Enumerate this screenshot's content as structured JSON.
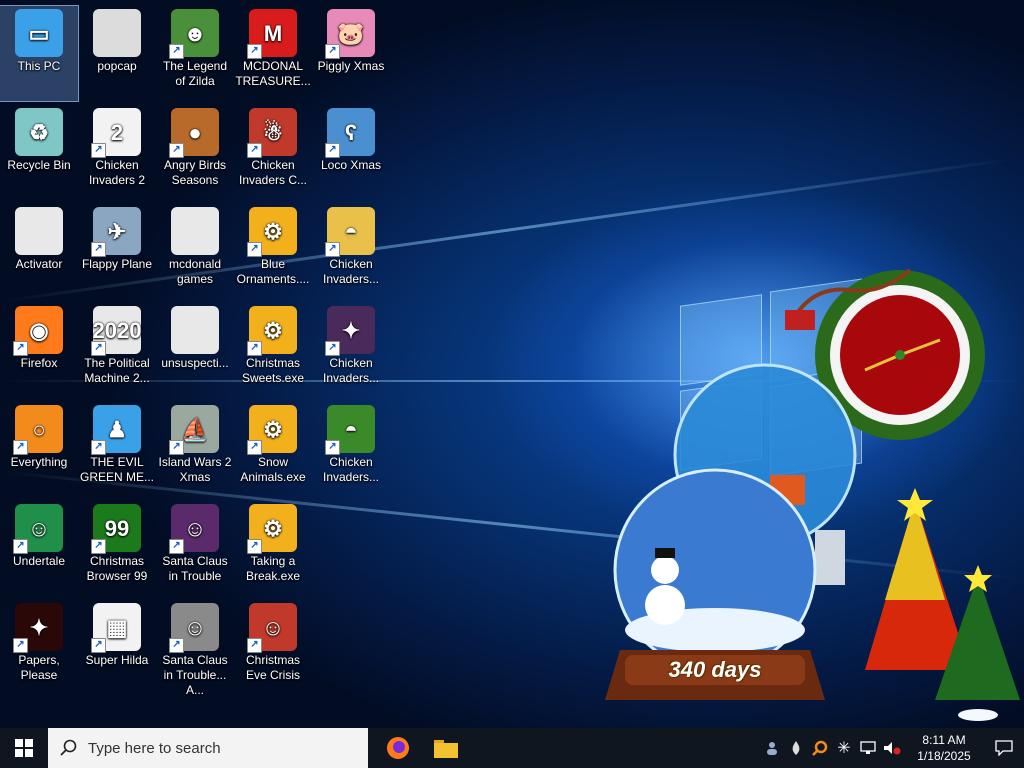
{
  "desktop": {
    "icons": [
      {
        "label": "This PC",
        "col": 0,
        "row": 0,
        "icon": "computer-icon",
        "color": "#3aa0e8",
        "glyph": "▭",
        "selected": true,
        "shortcut": false
      },
      {
        "label": "Recycle Bin",
        "col": 0,
        "row": 1,
        "icon": "recycle-bin-icon",
        "color": "#7fc6c6",
        "glyph": "♻",
        "shortcut": false
      },
      {
        "label": "Activator",
        "col": 0,
        "row": 2,
        "icon": "file-icon",
        "color": "#e8e8e8",
        "glyph": "",
        "shortcut": false
      },
      {
        "label": "Firefox",
        "col": 0,
        "row": 3,
        "icon": "firefox-icon",
        "color": "#ff7a1a",
        "glyph": "◉",
        "shortcut": true
      },
      {
        "label": "Everything",
        "col": 0,
        "row": 4,
        "icon": "magnifier-icon",
        "color": "#f28a1c",
        "glyph": "○",
        "shortcut": true
      },
      {
        "label": "Undertale",
        "col": 0,
        "row": 5,
        "icon": "undertale-icon",
        "color": "#1f8f4a",
        "glyph": "☺",
        "shortcut": true
      },
      {
        "label": "Papers, Please",
        "col": 0,
        "row": 6,
        "icon": "papers-please-icon",
        "color": "#2a0808",
        "glyph": "✦",
        "shortcut": true
      },
      {
        "label": "popcap",
        "col": 1,
        "row": 0,
        "icon": "folder-icon",
        "color": "#dcdcdc",
        "glyph": "",
        "shortcut": false
      },
      {
        "label": "Chicken Invaders 2",
        "col": 1,
        "row": 1,
        "icon": "chicken-icon",
        "color": "#f2f2f2",
        "glyph": "2",
        "shortcut": true
      },
      {
        "label": "Flappy Plane",
        "col": 1,
        "row": 2,
        "icon": "plane-icon",
        "color": "#8ba6c0",
        "glyph": "✈",
        "shortcut": true
      },
      {
        "label": "The Political Machine 2...",
        "col": 1,
        "row": 3,
        "icon": "political-icon",
        "color": "#e8e8e8",
        "glyph": "2020",
        "shortcut": true
      },
      {
        "label": "THE EVIL GREEN ME...",
        "col": 1,
        "row": 4,
        "icon": "msn-icon",
        "color": "#3aa0e8",
        "glyph": "♟",
        "shortcut": true
      },
      {
        "label": "Christmas Browser 99",
        "col": 1,
        "row": 5,
        "icon": "tree-icon",
        "color": "#1b7a1b",
        "glyph": "99",
        "shortcut": true
      },
      {
        "label": "Super Hilda",
        "col": 1,
        "row": 6,
        "icon": "pixel-icon",
        "color": "#f2f2f2",
        "glyph": "▦",
        "shortcut": true
      },
      {
        "label": "The Legend of Zilda",
        "col": 2,
        "row": 0,
        "icon": "zilda-icon",
        "color": "#4a8f3a",
        "glyph": "☻",
        "shortcut": true
      },
      {
        "label": "Angry Birds Seasons",
        "col": 2,
        "row": 1,
        "icon": "angry-birds-icon",
        "color": "#b86a2a",
        "glyph": "●",
        "shortcut": true
      },
      {
        "label": "mcdonald games",
        "col": 2,
        "row": 2,
        "icon": "folder-icon",
        "color": "#e8e8e8",
        "glyph": "",
        "shortcut": false
      },
      {
        "label": "unsuspecti...",
        "col": 2,
        "row": 3,
        "icon": "file-icon",
        "color": "#e8e8e8",
        "glyph": "",
        "shortcut": false
      },
      {
        "label": "Island Wars 2 Xmas",
        "col": 2,
        "row": 4,
        "icon": "island-icon",
        "color": "#9aa8a0",
        "glyph": "⛵",
        "shortcut": true
      },
      {
        "label": "Santa Claus in Trouble",
        "col": 2,
        "row": 5,
        "icon": "santa-icon",
        "color": "#5a2a6a",
        "glyph": "☺",
        "shortcut": true
      },
      {
        "label": "Santa Claus in Trouble... A...",
        "col": 2,
        "row": 6,
        "icon": "santa-icon",
        "color": "#8a8a8a",
        "glyph": "☺",
        "shortcut": true
      },
      {
        "label": "MCDONAL TREASURE...",
        "col": 3,
        "row": 0,
        "icon": "mcdonalds-icon",
        "color": "#d81b1b",
        "glyph": "M",
        "shortcut": true
      },
      {
        "label": "Chicken Invaders C...",
        "col": 3,
        "row": 1,
        "icon": "snowman-icon",
        "color": "#c0392b",
        "glyph": "☃",
        "shortcut": true
      },
      {
        "label": "Blue Ornaments....",
        "col": 3,
        "row": 2,
        "icon": "setup-icon",
        "color": "#f2b01c",
        "glyph": "⚙",
        "shortcut": true
      },
      {
        "label": "Christmas Sweets.exe",
        "col": 3,
        "row": 3,
        "icon": "setup-icon",
        "color": "#f2b01c",
        "glyph": "⚙",
        "shortcut": true
      },
      {
        "label": "Snow Animals.exe",
        "col": 3,
        "row": 4,
        "icon": "setup-icon",
        "color": "#f2b01c",
        "glyph": "⚙",
        "shortcut": true
      },
      {
        "label": "Taking a Break.exe",
        "col": 3,
        "row": 5,
        "icon": "setup-icon",
        "color": "#f2b01c",
        "glyph": "⚙",
        "shortcut": true
      },
      {
        "label": "Christmas Eve Crisis",
        "col": 3,
        "row": 6,
        "icon": "santa-icon",
        "color": "#c0392b",
        "glyph": "☺",
        "shortcut": true
      },
      {
        "label": "Piggly Xmas",
        "col": 4,
        "row": 0,
        "icon": "pig-icon",
        "color": "#e88ab8",
        "glyph": "🐷",
        "shortcut": true
      },
      {
        "label": "Loco Xmas",
        "col": 4,
        "row": 1,
        "icon": "bear-icon",
        "color": "#4a90d0",
        "glyph": "ʕ",
        "shortcut": true
      },
      {
        "label": "Chicken Invaders...",
        "col": 4,
        "row": 2,
        "icon": "chicken-icon",
        "color": "#e8c04a",
        "glyph": "◓",
        "shortcut": true
      },
      {
        "label": "Chicken Invaders...",
        "col": 4,
        "row": 3,
        "icon": "chicken-icon",
        "color": "#4a2a5a",
        "glyph": "✦",
        "shortcut": true
      },
      {
        "label": "Chicken Invaders...",
        "col": 4,
        "row": 4,
        "icon": "chicken-icon",
        "color": "#3a8a2a",
        "glyph": "◓",
        "shortcut": true
      }
    ]
  },
  "widget": {
    "days_label": "340 days"
  },
  "taskbar": {
    "search_placeholder": "Type here to search",
    "pinned": [
      {
        "name": "taskbar-firefox",
        "icon": "firefox-icon",
        "color": "#ff7a1a"
      },
      {
        "name": "taskbar-file-explorer",
        "icon": "folder-icon",
        "color": "#f2c230"
      }
    ],
    "clock_time": "8:11 AM",
    "clock_date": "1/18/2025"
  },
  "colors": {
    "taskbar_bg": "#0f1620",
    "search_bg": "#f3f3f3",
    "wallpaper_blue": "#0b4aa8"
  }
}
